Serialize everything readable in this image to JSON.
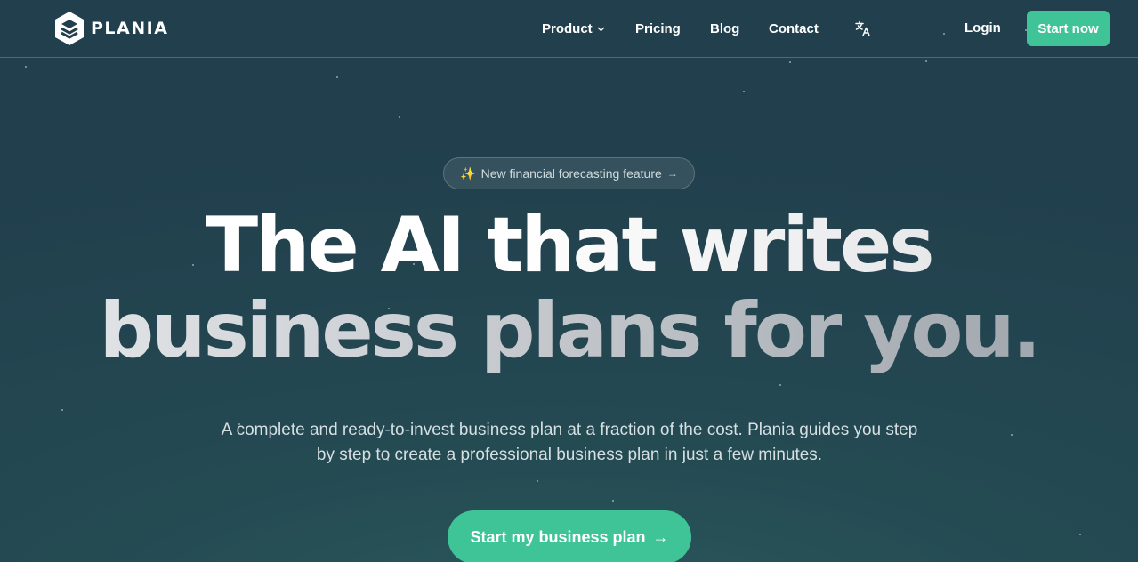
{
  "brand": {
    "name": "PLANIA",
    "icon": "stacked-layers-logo"
  },
  "nav": {
    "product": "Product",
    "pricing": "Pricing",
    "blog": "Blog",
    "contact": "Contact",
    "translate_icon": "translate-icon",
    "login": "Login",
    "start_now": "Start now"
  },
  "hero": {
    "badge": "New financial forecasting feature",
    "badge_emoji": "✨",
    "badge_arrow": "→",
    "headline_line1": "The AI that writes",
    "headline_line2": "business plans for you.",
    "subtitle": "A complete and ready-to-invest business plan at a fraction of the cost. Plania guides you step by step to create a professional business plan in just a few minutes.",
    "cta": "Start my business plan",
    "cta_arrow": "→"
  },
  "colors": {
    "background": "#223f4c",
    "accent": "#3fc498",
    "text": "#ffffff"
  }
}
